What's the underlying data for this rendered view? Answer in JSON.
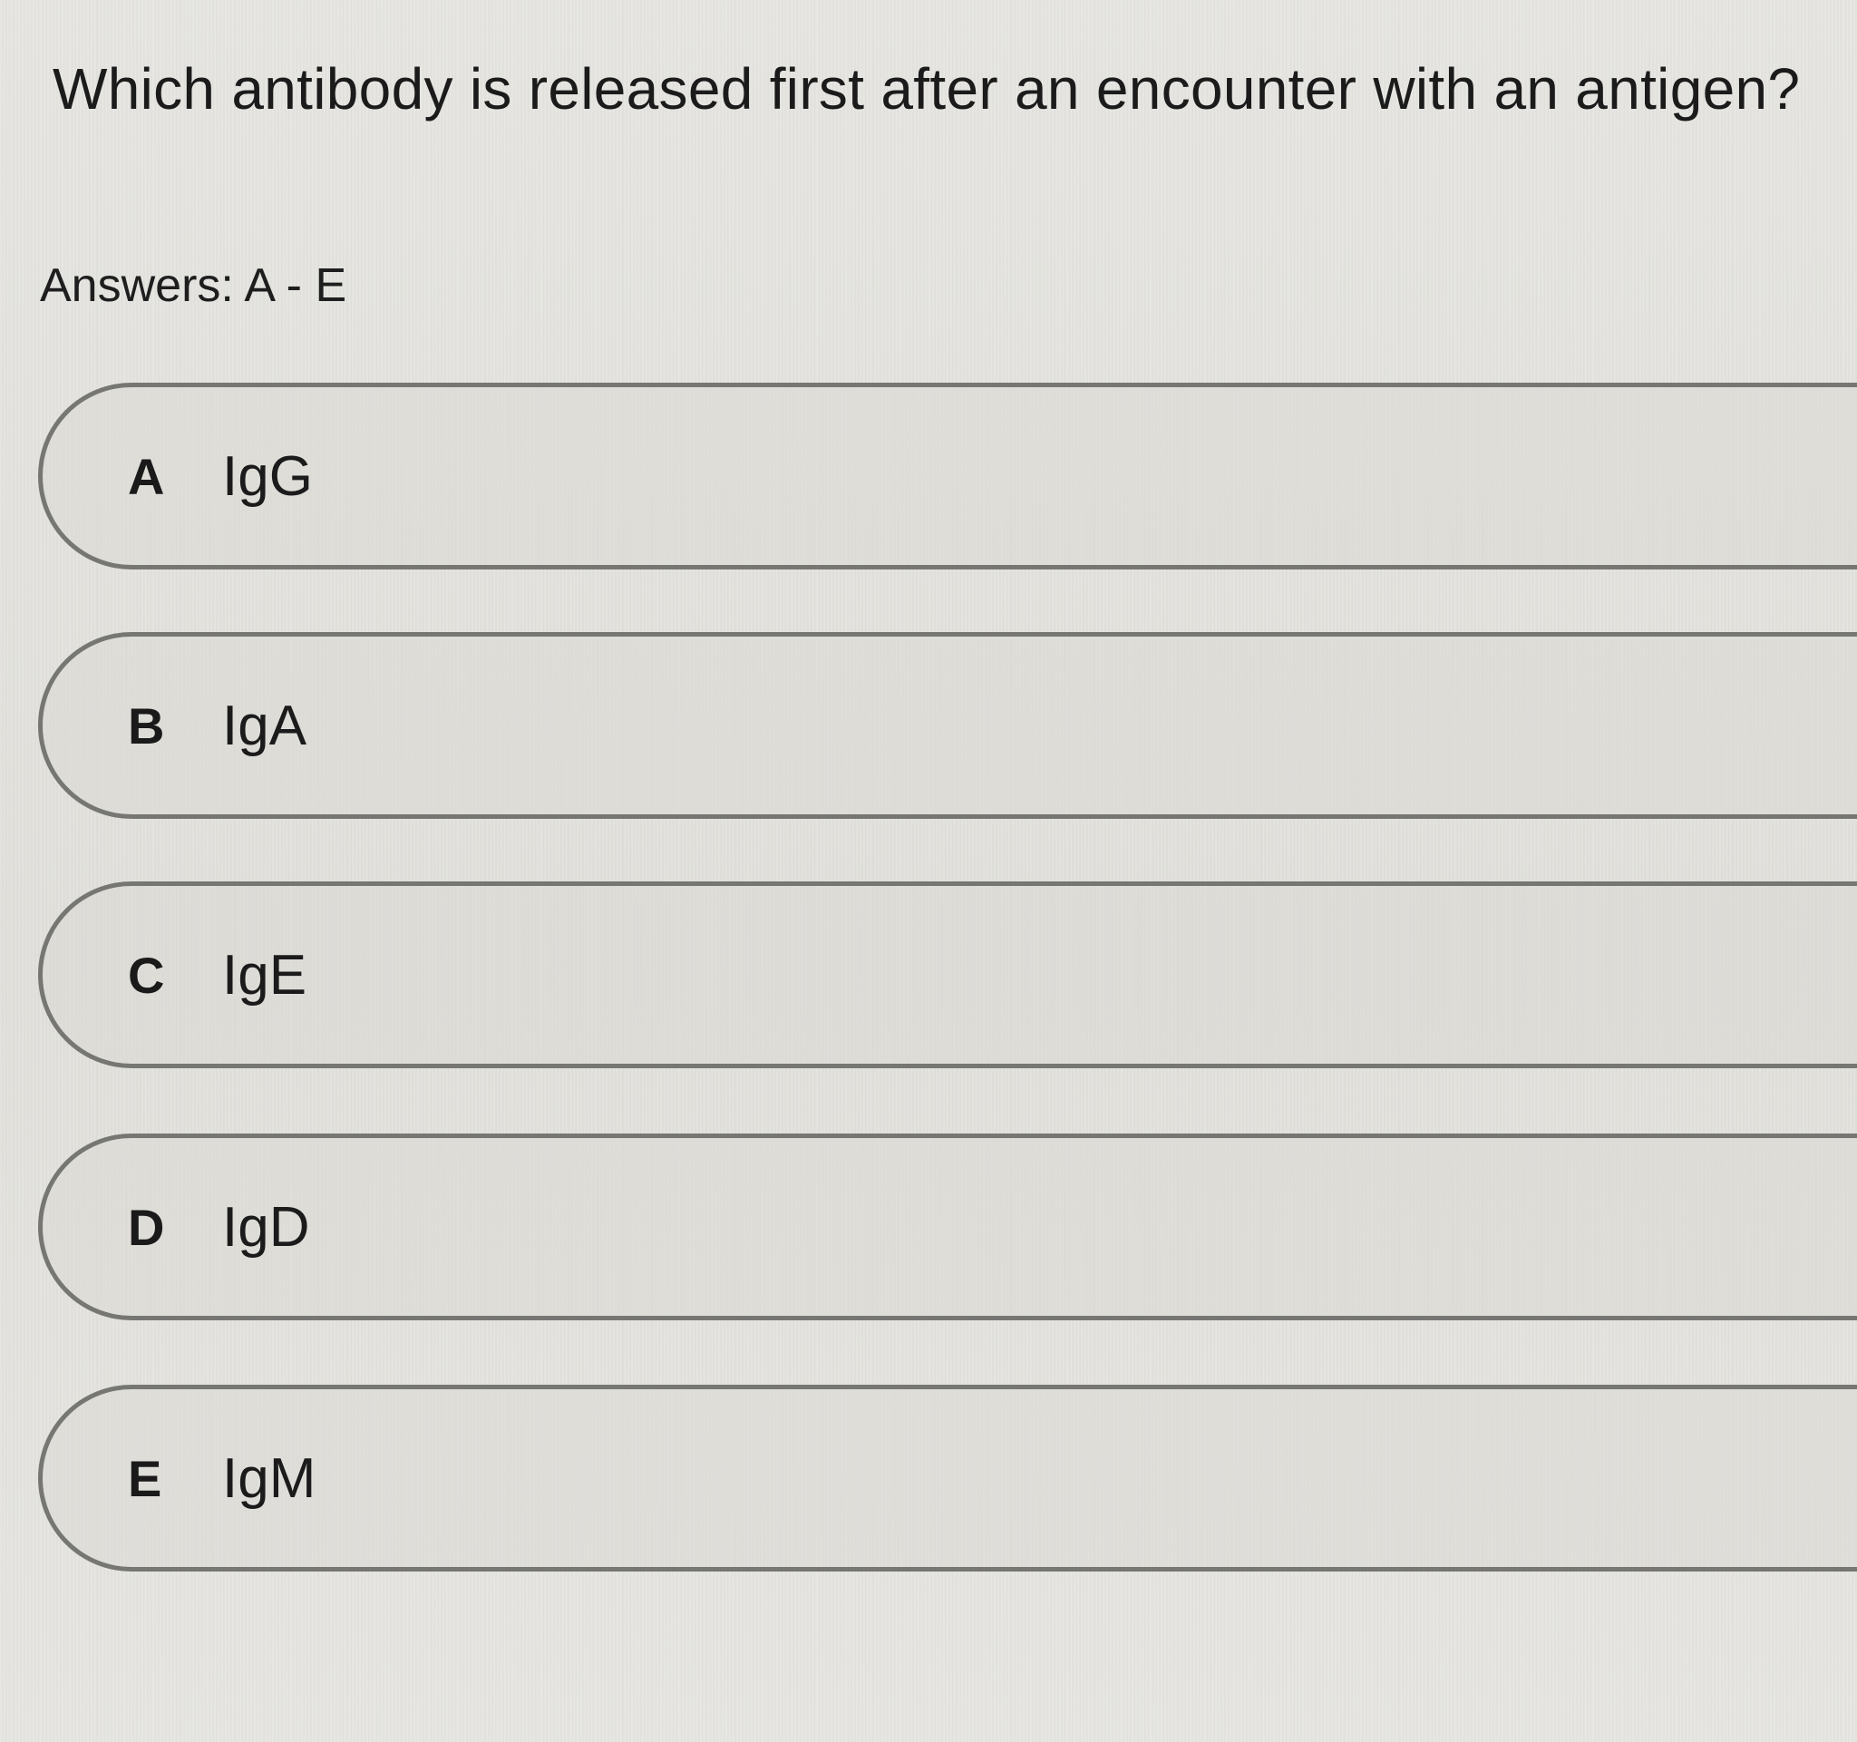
{
  "question": {
    "text": "Which antibody is released first after an encounter with an antigen?"
  },
  "answers_hint": "Answers: A - E",
  "options": [
    {
      "letter": "A",
      "label": "IgG"
    },
    {
      "letter": "B",
      "label": "IgA"
    },
    {
      "letter": "C",
      "label": "IgE"
    },
    {
      "letter": "D",
      "label": "IgD"
    },
    {
      "letter": "E",
      "label": "IgM"
    }
  ],
  "colors": {
    "background": "#e4e3de",
    "option_border": "#767673",
    "text": "#1b1b1b"
  }
}
